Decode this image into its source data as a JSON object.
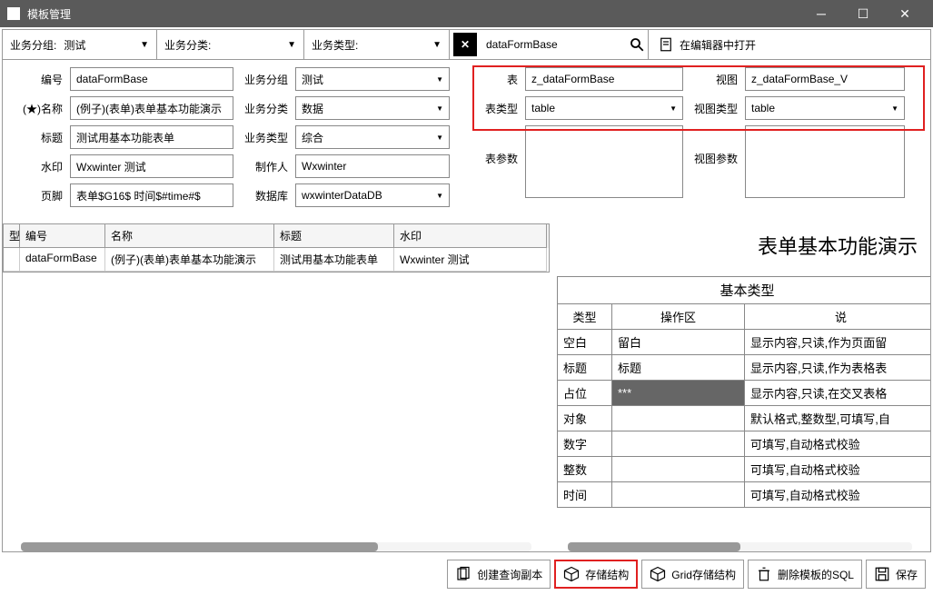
{
  "titlebar": {
    "title": "模板管理"
  },
  "filters": {
    "group_label": "业务分组:",
    "group_value": "测试",
    "category_label": "业务分类:",
    "type_label": "业务类型:",
    "search_value": "dataFormBase",
    "open_editor": "在编辑器中打开"
  },
  "form_left": {
    "id_label": "编号",
    "id_value": "dataFormBase",
    "name_label": "(★)名称",
    "name_value": "(例子)(表单)表单基本功能演示",
    "title_label": "标题",
    "title_value": "测试用基本功能表单",
    "wm_label": "水印",
    "wm_value": "Wxwinter 测试",
    "footer_label": "页脚",
    "footer_value": "表单$G16$ 时间$#time#$",
    "grp_label": "业务分组",
    "grp_value": "测试",
    "cat_label": "业务分类",
    "cat_value": "数据",
    "type_label": "业务类型",
    "type_value": "综合",
    "author_label": "制作人",
    "author_value": "Wxwinter",
    "db_label": "数据库",
    "db_value": "wxwinterDataDB"
  },
  "form_right": {
    "table_label": "表",
    "table_value": "z_dataFormBase",
    "view_label": "视图",
    "view_value": "z_dataFormBase_V",
    "ttype_label": "表类型",
    "ttype_value": "table",
    "vtype_label": "视图类型",
    "vtype_value": "table",
    "tparam_label": "表参数",
    "vparam_label": "视图参数"
  },
  "grid": {
    "headers": {
      "type": "型",
      "id": "编号",
      "name": "名称",
      "title": "标题",
      "wm": "水印"
    },
    "rows": [
      {
        "type": "",
        "id": "dataFormBase",
        "name": "(例子)(表单)表单基本功能演示",
        "title": "测试用基本功能表单",
        "wm": "Wxwinter 测试"
      }
    ]
  },
  "preview": {
    "title": "表单基本功能演示",
    "subhead": "基本类型",
    "cols": {
      "type": "类型",
      "op": "操作区",
      "desc": "说"
    },
    "rows": [
      {
        "type": "空白",
        "op": "留白",
        "desc": "显示内容,只读,作为页面留"
      },
      {
        "type": "标题",
        "op": "标题",
        "desc": "显示内容,只读,作为表格表"
      },
      {
        "type": "占位",
        "op": "***",
        "desc": "显示内容,只读,在交叉表格",
        "dark": true
      },
      {
        "type": "对象",
        "op": "",
        "desc": "默认格式,整数型,可填写,自"
      },
      {
        "type": "数字",
        "op": "",
        "desc": "可填写,自动格式校验"
      },
      {
        "type": "整数",
        "op": "",
        "desc": "可填写,自动格式校验"
      },
      {
        "type": "时间",
        "op": "",
        "desc": "可填写,自动格式校验"
      }
    ]
  },
  "toolbar": {
    "create_copy": "创建查询副本",
    "storage": "存储结构",
    "grid_storage": "Grid存储结构",
    "delete_sql": "删除模板的SQL",
    "save": "保存"
  }
}
